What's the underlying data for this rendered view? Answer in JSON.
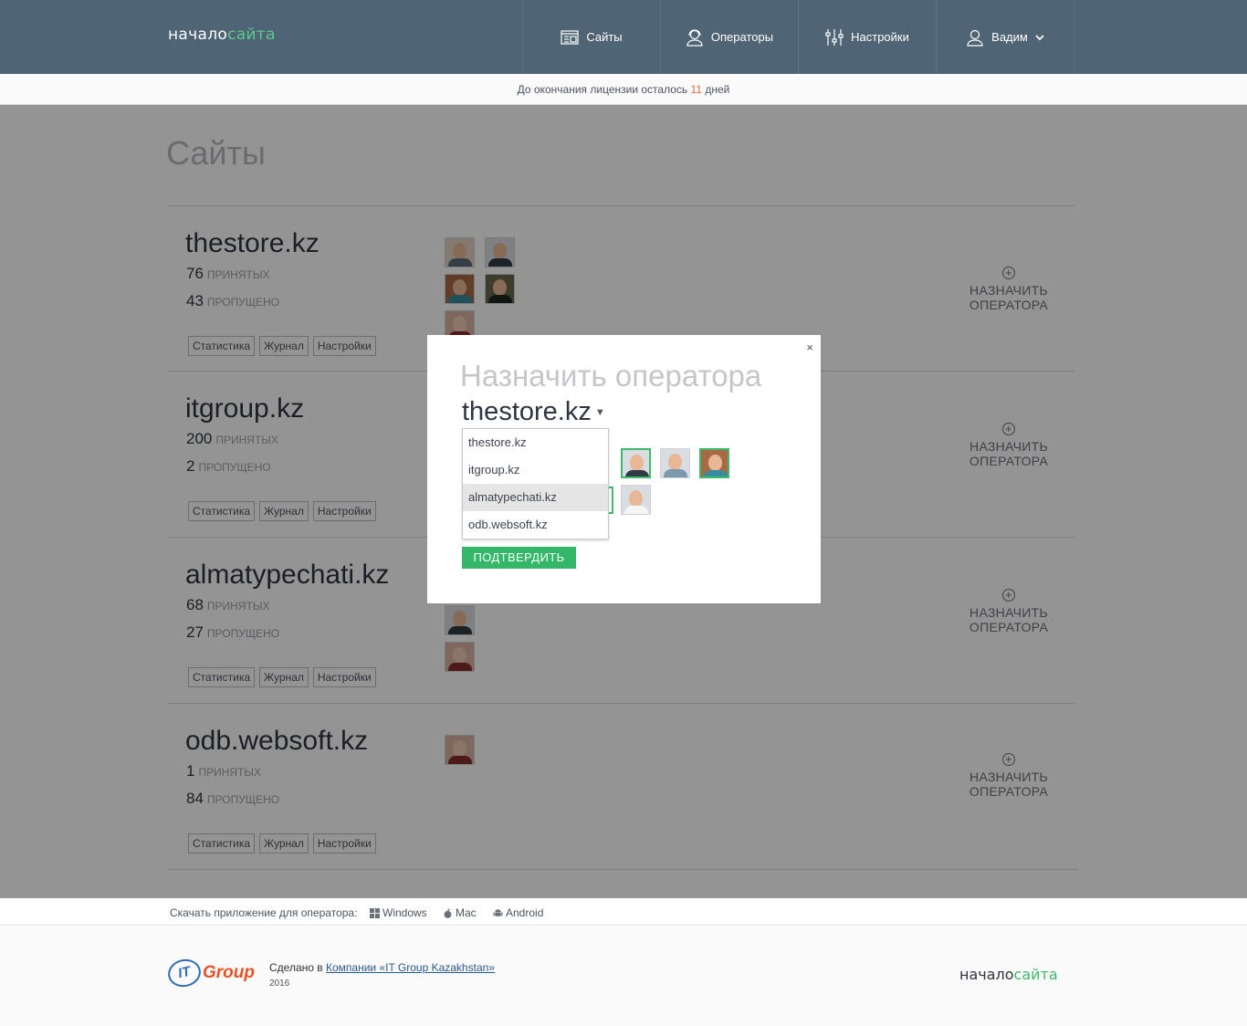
{
  "header": {
    "logo_part1": "начало",
    "logo_part2": "сайта",
    "nav": [
      {
        "label": "Сайты",
        "icon": "sites-icon"
      },
      {
        "label": "Операторы",
        "icon": "operator-icon"
      },
      {
        "label": "Настройки",
        "icon": "sliders-icon"
      },
      {
        "label": "Вадим",
        "icon": "user-icon"
      }
    ]
  },
  "license": {
    "text_before": "До окончания лицензии осталось",
    "days": "11",
    "text_after": "дней"
  },
  "page": {
    "title": "Сайты",
    "accepted_label": "принятых",
    "missed_label": "пропущено",
    "tags": [
      "Статистика",
      "Журнал",
      "Настройки"
    ],
    "assign_label_1": "НАЗНАЧИТЬ",
    "assign_label_2": "ОПЕРАТОРА"
  },
  "sites": [
    {
      "name": "thestore.kz",
      "accepted": "76",
      "missed": "43"
    },
    {
      "name": "itgroup.kz",
      "accepted": "200",
      "missed": "2"
    },
    {
      "name": "almatypechati.kz",
      "accepted": "68",
      "missed": "27"
    },
    {
      "name": "odb.websoft.kz",
      "accepted": "1",
      "missed": "84"
    }
  ],
  "modal": {
    "close": "×",
    "title": "Назначить оператора",
    "selected_site": "thestore.kz",
    "dropdown_options": [
      "thestore.kz",
      "itgroup.kz",
      "almatypechati.kz",
      "odb.websoft.kz"
    ],
    "highlighted_option": "almatypechati.kz",
    "confirm_label": "ПОДТВЕРДИТЬ"
  },
  "download": {
    "label": "Скачать приложение для оператора:",
    "windows": "Windows",
    "mac": "Mac",
    "android": "Android"
  },
  "footer": {
    "itg_it": "IT",
    "itg_group": "Group",
    "made_prefix": "Сделано в",
    "made_link": "Компании «IT Group Kazakhstan»",
    "year": "2016",
    "logo_part1": "начало",
    "logo_part2": "сайта"
  },
  "colors": {
    "header_bg": "#4f6474",
    "accent_green": "#34b768",
    "days_orange": "#f0653e"
  }
}
